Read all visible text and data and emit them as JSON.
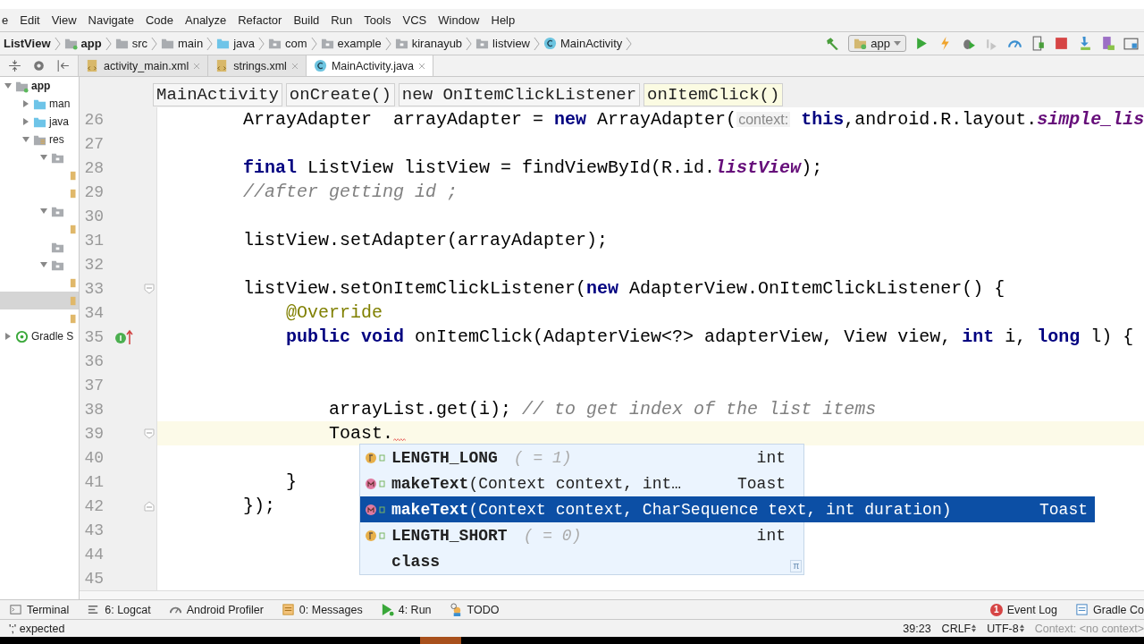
{
  "menu": [
    "e",
    "Edit",
    "View",
    "Navigate",
    "Code",
    "Analyze",
    "Refactor",
    "Build",
    "Run",
    "Tools",
    "VCS",
    "Window",
    "Help"
  ],
  "breadcrumbs": [
    {
      "label": "ListView",
      "kind": "project"
    },
    {
      "label": "app",
      "kind": "module"
    },
    {
      "label": "src",
      "kind": "folder"
    },
    {
      "label": "main",
      "kind": "folder"
    },
    {
      "label": "java",
      "kind": "source"
    },
    {
      "label": "com",
      "kind": "package"
    },
    {
      "label": "example",
      "kind": "package"
    },
    {
      "label": "kiranayub",
      "kind": "package"
    },
    {
      "label": "listview",
      "kind": "package"
    },
    {
      "label": "MainActivity",
      "kind": "class"
    }
  ],
  "run_config": "app",
  "tabs": [
    {
      "label": "activity_main.xml",
      "kind": "xml",
      "selected": false
    },
    {
      "label": "strings.xml",
      "kind": "xml",
      "selected": false
    },
    {
      "label": "MainActivity.java",
      "kind": "class",
      "selected": true
    }
  ],
  "project_tree": [
    {
      "label": "app",
      "kind": "module",
      "expanded": true,
      "selected": false,
      "children": [
        {
          "label": "man",
          "kind": "source",
          "expanded": false,
          "selected": false
        },
        {
          "label": "java",
          "kind": "source",
          "expanded": false,
          "selected": false
        },
        {
          "label": "res",
          "kind": "res",
          "expanded": true,
          "selected": false,
          "children": [
            {
              "kind": "folder",
              "expanded": true,
              "selected": false,
              "children": [
                {
                  "kind": "file",
                  "selected": false
                },
                {
                  "kind": "file",
                  "selected": false
                }
              ]
            },
            {
              "kind": "folder",
              "expanded": true,
              "selected": false,
              "children": [
                {
                  "kind": "file",
                  "selected": false
                }
              ]
            },
            {
              "kind": "folder",
              "expanded": false,
              "selected": false
            },
            {
              "kind": "folder",
              "expanded": true,
              "selected": false,
              "children": [
                {
                  "kind": "file",
                  "selected": false
                },
                {
                  "kind": "file",
                  "selected": true
                },
                {
                  "kind": "file",
                  "selected": false
                }
              ]
            }
          ]
        }
      ]
    },
    {
      "label": "Gradle S",
      "kind": "gradle",
      "expanded": false,
      "selected": false
    }
  ],
  "structure_path": [
    {
      "label": "MainActivity",
      "selected": false
    },
    {
      "label": "onCreate()",
      "selected": false
    },
    {
      "label": "new OnItemClickListener",
      "selected": false
    },
    {
      "label": "onItemClick()",
      "selected": true
    }
  ],
  "code_lines": [
    {
      "number": "26",
      "current": false,
      "error": false,
      "segments": [
        {
          "kind": "plain",
          "text": "        ArrayAdapter  arrayAdapter = "
        },
        {
          "kind": "keyword",
          "text": "new"
        },
        {
          "kind": "plain",
          "text": " ArrayAdapter("
        },
        {
          "kind": "hint",
          "text": "context:"
        },
        {
          "kind": "keyword",
          "text": "this"
        },
        {
          "kind": "plain",
          "text": ",android.R.layout."
        },
        {
          "kind": "static",
          "text": "simple_lis"
        }
      ]
    },
    {
      "number": "27",
      "current": false,
      "error": false
    },
    {
      "number": "28",
      "current": false,
      "error": false,
      "segments": [
        {
          "kind": "keyword",
          "text": "        final"
        },
        {
          "kind": "plain",
          "text": " ListView listView = findViewById(R.id."
        },
        {
          "kind": "static",
          "text": "listView"
        },
        {
          "kind": "plain",
          "text": ");"
        }
      ]
    },
    {
      "number": "29",
      "current": false,
      "error": false,
      "segments": [
        {
          "kind": "comment",
          "text": "        //after getting id ;"
        }
      ]
    },
    {
      "number": "30",
      "current": false,
      "error": false
    },
    {
      "number": "31",
      "current": false,
      "error": false,
      "segments": [
        {
          "kind": "plain",
          "text": "        listView.setAdapter(arrayAdapter);"
        }
      ]
    },
    {
      "number": "32",
      "current": false,
      "error": false
    },
    {
      "number": "33",
      "current": false,
      "error": false,
      "gutter": {
        "kind": "fold_start"
      },
      "segments": [
        {
          "kind": "plain",
          "text": "        listView.setOnItemClickListener("
        },
        {
          "kind": "keyword",
          "text": "new"
        },
        {
          "kind": "plain",
          "text": " AdapterView.OnItemClickListener() {"
        }
      ]
    },
    {
      "number": "34",
      "current": false,
      "error": false,
      "segments": [
        {
          "kind": "annotation",
          "text": "            @Override"
        }
      ]
    },
    {
      "number": "35",
      "current": false,
      "error": false,
      "gutter": {
        "kind": "implements"
      },
      "segments": [
        {
          "kind": "keyword",
          "text": "            public void"
        },
        {
          "kind": "plain",
          "text": " onItemClick(AdapterView<?> adapterView, View view, "
        },
        {
          "kind": "keyword",
          "text": "int"
        },
        {
          "kind": "plain",
          "text": " i, "
        },
        {
          "kind": "keyword",
          "text": "long"
        },
        {
          "kind": "plain",
          "text": " l) {"
        }
      ]
    },
    {
      "number": "36",
      "current": false,
      "error": false
    },
    {
      "number": "37",
      "current": false,
      "error": false
    },
    {
      "number": "38",
      "current": false,
      "error": false,
      "segments": [
        {
          "kind": "plain",
          "text": "                arrayList.get(i); "
        },
        {
          "kind": "comment",
          "text": "// to get index of the list items"
        }
      ]
    },
    {
      "number": "39",
      "current": true,
      "error": true,
      "gutter": {
        "kind": "fold_start"
      },
      "segments": [
        {
          "kind": "plain",
          "text": "                Toast."
        }
      ]
    },
    {
      "number": "40",
      "current": false,
      "error": false
    },
    {
      "number": "41",
      "current": false,
      "error": false,
      "segments": [
        {
          "kind": "plain",
          "text": "            }"
        }
      ]
    },
    {
      "number": "42",
      "current": false,
      "error": false,
      "gutter": {
        "kind": "fold_end"
      },
      "segments": [
        {
          "kind": "plain",
          "text": "        });"
        }
      ]
    },
    {
      "number": "43",
      "current": false,
      "error": false
    },
    {
      "number": "44",
      "current": false,
      "error": false
    },
    {
      "number": "45",
      "current": false,
      "error": false
    }
  ],
  "completion": {
    "items": [
      {
        "kind": "field",
        "name": "LENGTH_LONG",
        "detail": "( = 1)",
        "type": "int",
        "selected": false
      },
      {
        "kind": "method",
        "name": "makeText",
        "detail": "(Context context, int…",
        "type": "Toast",
        "selected": false
      },
      {
        "kind": "method",
        "name": "makeText",
        "detail": "(Context context, CharSequence text, int duration)",
        "type": "Toast",
        "selected": true
      },
      {
        "kind": "field",
        "name": "LENGTH_SHORT",
        "detail": "( = 0)",
        "type": "int",
        "selected": false
      },
      {
        "kind": "keyword",
        "name": "class",
        "selected": false
      }
    ],
    "corner_glyph": "π"
  },
  "tool_windows_left": [
    {
      "label": "Terminal",
      "kind": "terminal"
    },
    {
      "label": "6: Logcat",
      "kind": "logcat"
    },
    {
      "label": "Android Profiler",
      "kind": "profiler"
    },
    {
      "label": "0: Messages",
      "kind": "messages"
    },
    {
      "label": "4: Run",
      "kind": "run"
    },
    {
      "label": "TODO",
      "kind": "todo"
    }
  ],
  "tool_windows_right": [
    {
      "label": "Event Log",
      "kind": "event",
      "badge": "1"
    },
    {
      "label": "Gradle Co",
      "kind": "gradle"
    }
  ],
  "status": {
    "message": "';' expected",
    "position": "39:23",
    "line_separator": "CRLF",
    "encoding": "UTF-8",
    "context": "Context: <no context>"
  }
}
